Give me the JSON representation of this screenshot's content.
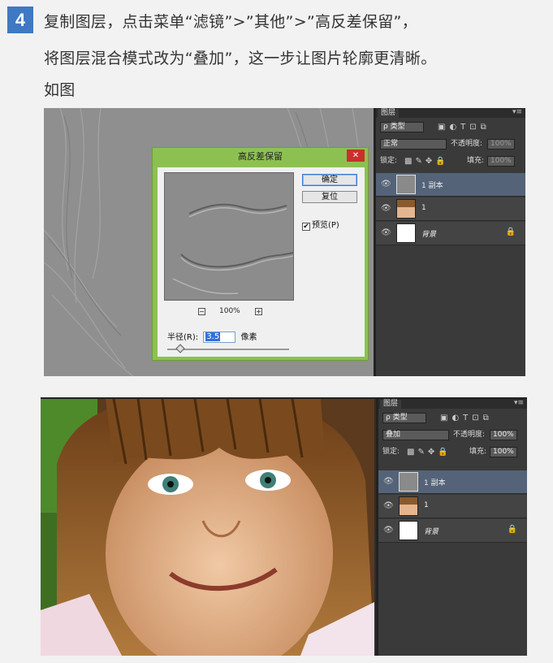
{
  "step": {
    "number": "4"
  },
  "text": {
    "line1": "复制图层，点击菜单“滤镜”>”其他”>”高反差保留”，",
    "line2": "将图层混合模式改为“叠加”，这一步让图片轮廓更清晰。",
    "line3": "如图"
  },
  "dialog": {
    "title": "高反差保留",
    "close": "✕",
    "ok": "确定",
    "reset": "复位",
    "preview": "预览(P)",
    "zoom": "100%",
    "zoom_out": "−",
    "zoom_in": "+",
    "radius_label": "半径(R):",
    "radius_value": "3.5",
    "unit": "像素"
  },
  "panel1": {
    "tab": "图层",
    "menu": "▾≡",
    "filter": "ρ 类型",
    "blend": "正常",
    "opacity_label": "不透明度:",
    "opacity": "100%",
    "lock_label": "锁定:",
    "fill_label": "填充:",
    "fill": "100%",
    "layers": [
      {
        "name": "1 副本"
      },
      {
        "name": "1"
      },
      {
        "name": "背景"
      }
    ]
  },
  "panel2": {
    "tab": "图层",
    "menu": "▾≡",
    "filter": "ρ 类型",
    "blend": "叠加",
    "opacity_label": "不透明度:",
    "opacity": "100%",
    "lock_label": "锁定:",
    "fill_label": "填充:",
    "fill": "100%",
    "layers": [
      {
        "name": "1 副本"
      },
      {
        "name": "1"
      },
      {
        "name": "背景"
      }
    ]
  },
  "icons": {
    "eye": "👁",
    "lock": "🔒",
    "check": "✔"
  }
}
